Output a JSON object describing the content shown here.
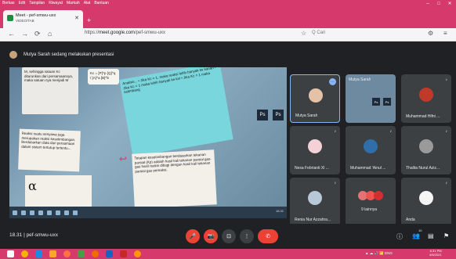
{
  "browser": {
    "menu": [
      "Berkas",
      "Edit",
      "Tampilan",
      "Riwayat",
      "Markah",
      "Alat",
      "Bantuan"
    ],
    "window_controls": [
      "–",
      "□",
      "✕"
    ],
    "tab": {
      "title": "Meet - pef-smwu-uxx",
      "subtitle": "VIDEO/TAB",
      "close": "✕"
    },
    "new_tab": "+",
    "nav": [
      "←",
      "→",
      "⟳",
      "⌂"
    ],
    "url": {
      "scheme": "https://",
      "host": "meet.google.com",
      "path": "/pef-smwu-uxx"
    },
    "search_placeholder": "Q  Cari",
    "star": "☆",
    "toolbar_icons": [
      "⚙",
      "≡"
    ]
  },
  "meet": {
    "presenter_banner": "Mutya Sarah sedang melakukan presentasi",
    "slide": {
      "note1": "M, sehingga satuan Kc diturunkan dari persamaannya, maka satuan nya menjadi M",
      "formula": "Kc = [P]^p [Q]^q / [A]^a [B]^b",
      "note3": "Analisis... • Jika Kc > 1, maka reaksi lebih banyak ke kanan • Jika Kc < 1 maka lebih banyak ke kiri • Jika Kc = 1 maka setimbang",
      "note4": "Reaksi suatu senyawa juga merupakan reaksi kesetimbangan. Berdasarkan data dari persamaan dalam sistem tertutup tertentu...",
      "note6": "Tetapan kesetimbangan berdasarkan tekanan parsial (Kp) adalah hasil kali tekanan parsial gas-gas hasil reaksi dibagi dengan hasil kali tekanan parsial gas pereaksi.",
      "ps_label": "Ps",
      "big_letter": "α",
      "clock": "18.31"
    },
    "participants": [
      {
        "name": "Mutya Sarah",
        "active": true,
        "menu": "⋯"
      },
      {
        "name": "Mutya Sarah",
        "preview": true
      },
      {
        "name": "Muhammad Hifni ..."
      },
      {
        "name": "Nesa Febrianti Xl ..."
      },
      {
        "name": "Muhammad 'Ainul ..."
      },
      {
        "name": "Thalita Nurul Aziz..."
      },
      {
        "name": "Renia Nur Azzahra..."
      },
      {
        "name": "9 lainnya"
      },
      {
        "name": "Anda"
      }
    ],
    "mic_glyph": "♪",
    "bottom": {
      "time_code": "18.31  |  pef-smwu-uxx",
      "controls": [
        "🎤",
        "📷",
        "⊡",
        "⋮",
        "✆"
      ],
      "right_icons": [
        "ⓘ",
        "👥",
        "▤",
        "⚑"
      ],
      "people_count": "10"
    }
  },
  "windows": {
    "tray": "▲ ☁ 🔊 📶 ENG",
    "time": "6.31 PM",
    "date": "4/5/2021"
  },
  "colors": {
    "accent": "#d63a6c",
    "meet_bg": "#202124",
    "tile_bg": "#3c4043",
    "red": "#ea4335"
  }
}
